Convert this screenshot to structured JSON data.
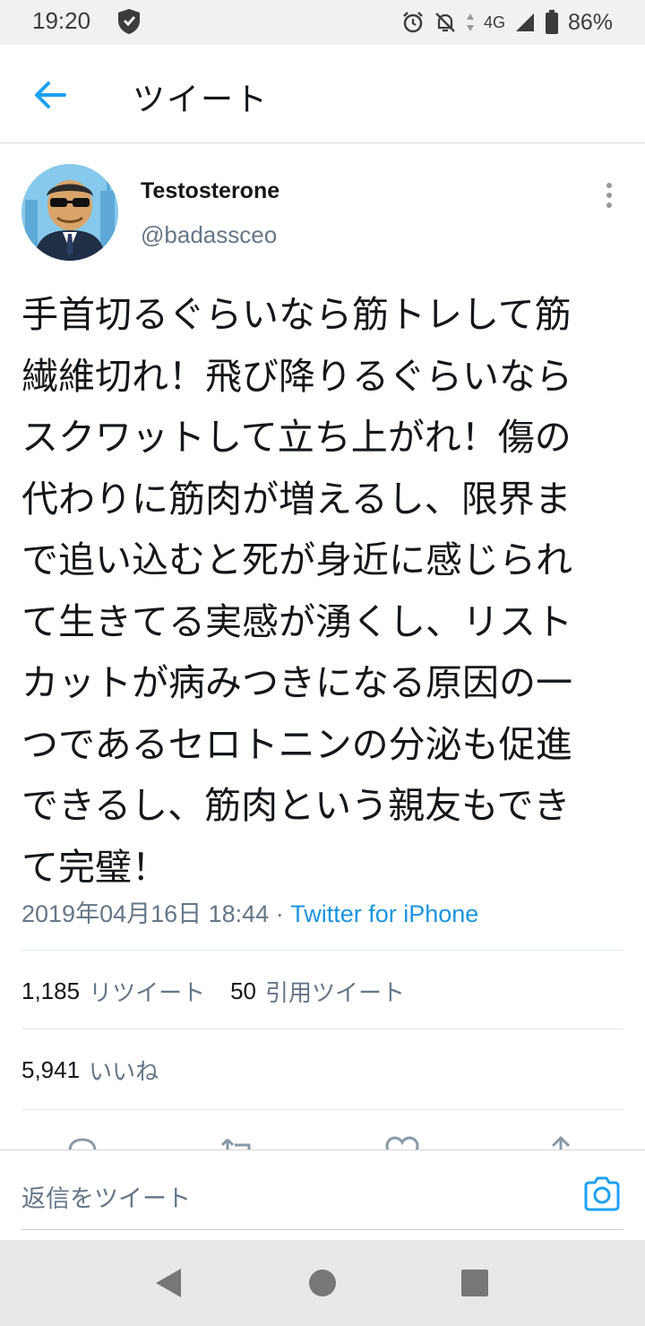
{
  "status_bar": {
    "time": "19:20",
    "network": "4G",
    "battery": "86%",
    "icons": [
      "shield-icon",
      "alarm-icon",
      "notifications-off-icon",
      "data-arrows-icon",
      "signal-icon",
      "battery-icon"
    ]
  },
  "header": {
    "title": "ツイート",
    "back_icon": "arrow-left-icon"
  },
  "tweet": {
    "author": {
      "name": "Testosterone",
      "handle": "@badassceo"
    },
    "text_lines": [
      "手首切るぐらいなら筋トレして筋",
      "繊維切れ！飛び降りるぐらいなら",
      "スクワットして立ち上がれ！傷の",
      "代わりに筋肉が増えるし、限界ま",
      "で追い込むと死が身近に感じられ",
      "て生きてる実感が湧くし、リスト",
      "カットが病みつきになる原因の一",
      "つであるセロトニンの分泌も促進",
      "できるし、筋肉という親友もでき",
      "て完璧！"
    ],
    "timestamp": "2019年04月16日 18:44",
    "separator": " · ",
    "source": "Twitter for iPhone",
    "retweets": {
      "count": "1,185",
      "label": "リツイート"
    },
    "quotes": {
      "count": "50",
      "label": "引用ツイート"
    },
    "likes": {
      "count": "5,941",
      "label": "いいね"
    }
  },
  "action_bar": [
    "reply-icon",
    "retweet-icon",
    "like-icon",
    "share-icon"
  ],
  "reply_box": {
    "placeholder": "返信をツイート",
    "camera_icon": "camera-icon"
  },
  "nav_bar": [
    "back-triangle-icon",
    "home-circle-icon",
    "recents-square-icon"
  ],
  "colors": {
    "accent": "#1da1f2",
    "link": "#1b95e0",
    "secondary_text": "#657786",
    "primary_text": "#14171a",
    "status_bar_bg": "#f1f1f1",
    "nav_bar_bg": "#e8e8e8"
  }
}
